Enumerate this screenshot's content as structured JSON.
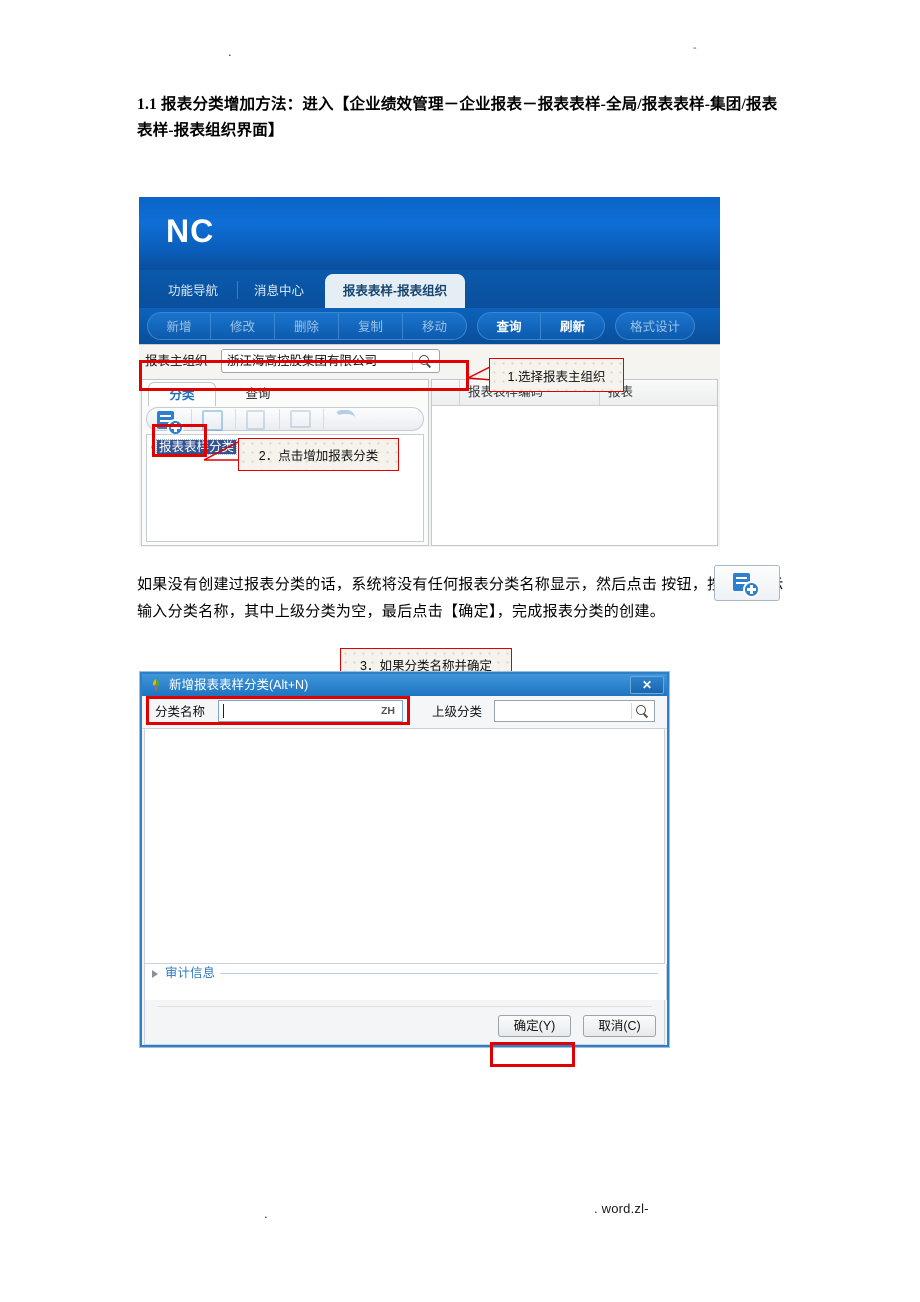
{
  "page": {
    "header_left_mark": ".",
    "header_right_mark": "-",
    "footer_left_mark": ".",
    "footer_right_mark": ". word.zl-"
  },
  "document": {
    "heading": "1.1 报表分类增加方法：进入【企业绩效管理－企业报表－报表表样-全局/报表表样-集团/报表表样-报表组织界面】",
    "paragraph": "如果没有创建过报表分类的话，系统将没有任何报表分类名称显示，然后点击          按钮，按屏幕提示输入分类名称，其中上级分类为空，最后点击【确定】，完成报表分类的创建。"
  },
  "nc_app": {
    "logo": "NC",
    "tabs": [
      {
        "label": "功能导航",
        "active": false
      },
      {
        "label": "消息中心",
        "active": false
      },
      {
        "label": "报表表样-报表组织",
        "active": true
      }
    ],
    "toolbar": [
      {
        "label": "新增",
        "enabled": false
      },
      {
        "label": "修改",
        "enabled": false
      },
      {
        "label": "删除",
        "enabled": false
      },
      {
        "label": "复制",
        "enabled": false
      },
      {
        "label": "移动",
        "enabled": false
      },
      {
        "label": "查询",
        "enabled": true
      },
      {
        "label": "刷新",
        "enabled": true
      },
      {
        "label": "格式设计",
        "enabled": false
      }
    ],
    "org_row": {
      "label": "报表主组织",
      "value": "浙江海高控股集团有限公司",
      "search_icon": "magnifier-icon"
    },
    "left_panel": {
      "tabs": [
        {
          "label": "分类",
          "active": true
        },
        {
          "label": "查询",
          "active": false
        }
      ],
      "tool_icons": [
        "add-category-icon",
        "edit-icon",
        "copy-icon",
        "delete-icon",
        "refresh-icon"
      ],
      "tree": {
        "root_label": "报表表样分类",
        "selected": true
      }
    },
    "grid": {
      "columns": [
        "",
        "报表表样编码",
        "报表"
      ],
      "rows": []
    }
  },
  "callouts": [
    {
      "id": "callout-1",
      "text": "1.选择报表主组织"
    },
    {
      "id": "callout-2",
      "text": "2．点击增加报表分类"
    },
    {
      "id": "callout-3",
      "text": "3．如果分类名称并确定"
    }
  ],
  "dialog": {
    "title": "新增报表表样分类(Alt+N)",
    "title_icon": "leaf-icon",
    "close_label": "✕",
    "fields": [
      {
        "label": "分类名称",
        "value": "",
        "ime_flag": "ZH",
        "has_search": false
      },
      {
        "label": "上级分类",
        "value": "",
        "ime_flag": "",
        "has_search": true,
        "search_icon": "magnifier-icon"
      }
    ],
    "audit_section": {
      "label": "审计信息",
      "expander": "triangle-right-icon"
    },
    "buttons": [
      {
        "label": "确定(Y)",
        "primary": true
      },
      {
        "label": "取消(C)",
        "primary": false
      }
    ]
  },
  "inline_image": {
    "button_icon": "add-category-icon"
  }
}
